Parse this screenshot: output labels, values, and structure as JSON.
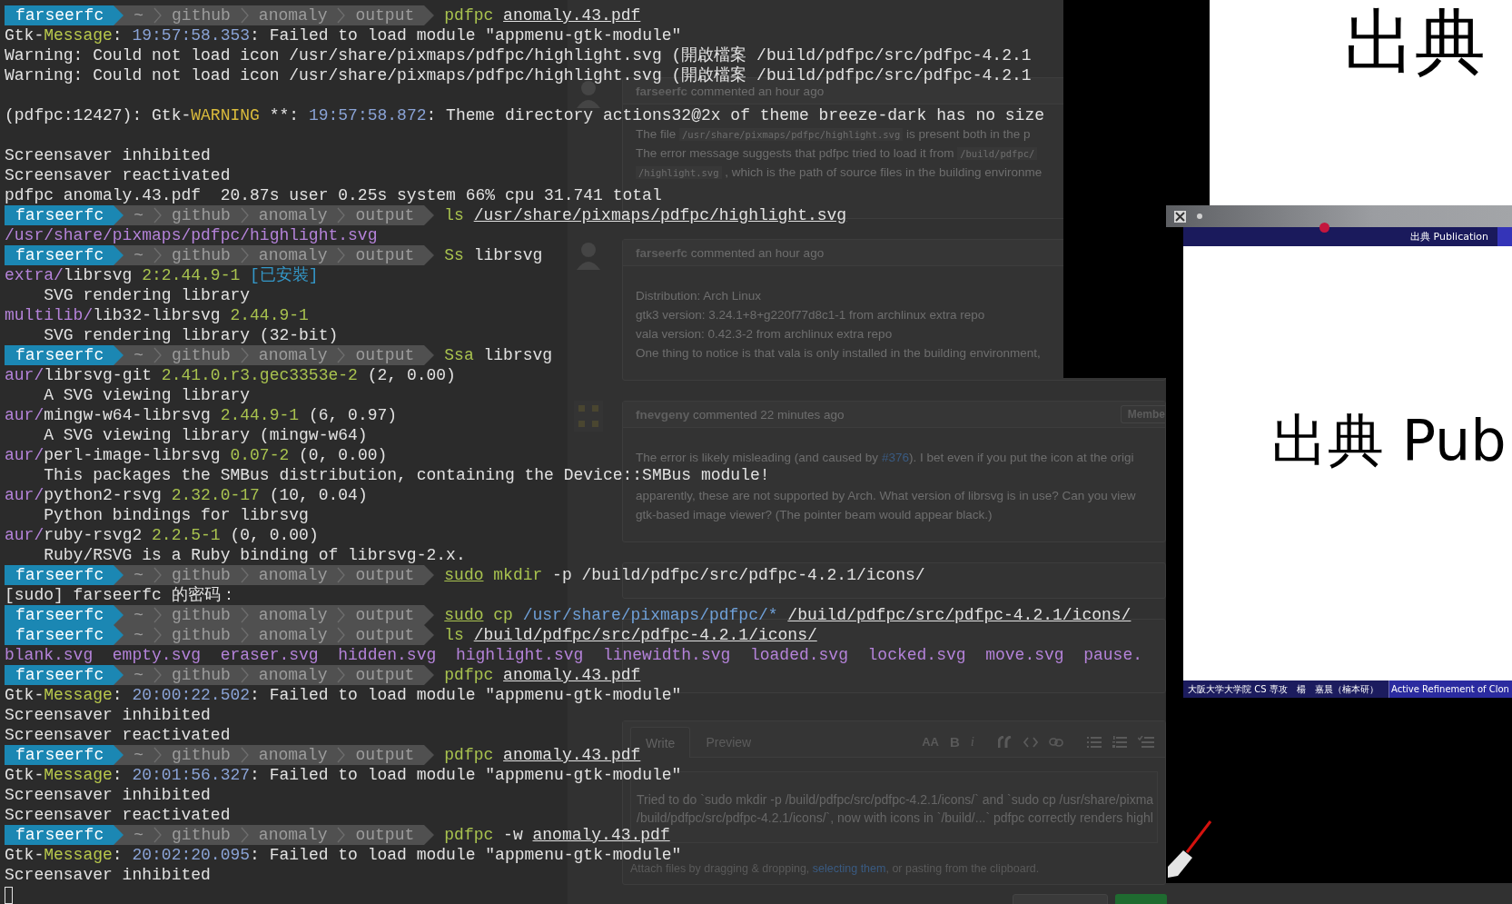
{
  "terminal": {
    "lines": [
      {
        "kind": "prompt",
        "user": "farseerfc",
        "path": [
          "~",
          "github",
          "anomaly",
          "output"
        ],
        "command": [
          {
            "kind": "cmd",
            "t": "pdfpc"
          },
          {
            "kind": "u",
            "t": "anomaly.43.pdf"
          }
        ]
      },
      {
        "kind": "text",
        "spans": [
          {
            "kind": "plain",
            "t": "Gtk-"
          },
          {
            "kind": "msg",
            "t": "Message"
          },
          {
            "kind": "plain",
            "t": ": "
          },
          {
            "kind": "time",
            "t": "19:57:58.353"
          },
          {
            "kind": "plain",
            "t": ": Failed to load module \"appmenu-gtk-module\""
          }
        ]
      },
      {
        "kind": "text",
        "spans": [
          {
            "kind": "plain",
            "t": "Warning: Could not load icon /usr/share/pixmaps/pdfpc/highlight.svg (開啟檔案 /build/pdfpc/src/pdfpc-4.2.1"
          }
        ]
      },
      {
        "kind": "text",
        "spans": [
          {
            "kind": "plain",
            "t": "Warning: Could not load icon /usr/share/pixmaps/pdfpc/highlight.svg (開啟檔案 /build/pdfpc/src/pdfpc-4.2.1"
          }
        ]
      },
      {
        "kind": "blank"
      },
      {
        "kind": "text",
        "spans": [
          {
            "kind": "plain",
            "t": "(pdfpc:12427): Gtk-"
          },
          {
            "kind": "warn",
            "t": "WARNING"
          },
          {
            "kind": "plain",
            "t": " **: "
          },
          {
            "kind": "time",
            "t": "19:57:58.872"
          },
          {
            "kind": "plain",
            "t": ": Theme directory actions32@2x of theme breeze-dark has no size"
          }
        ]
      },
      {
        "kind": "blank"
      },
      {
        "kind": "text",
        "spans": [
          {
            "kind": "plain",
            "t": "Screensaver inhibited"
          }
        ]
      },
      {
        "kind": "text",
        "spans": [
          {
            "kind": "plain",
            "t": "Screensaver reactivated"
          }
        ]
      },
      {
        "kind": "text",
        "spans": [
          {
            "kind": "plain",
            "t": "pdfpc anomaly.43.pdf  20.87s user 0.25s system 66% cpu 31.741 total"
          }
        ]
      },
      {
        "kind": "prompt",
        "user": "farseerfc",
        "path": [
          "~",
          "github",
          "anomaly",
          "output"
        ],
        "command": [
          {
            "kind": "cmd",
            "t": "ls"
          },
          {
            "kind": "u",
            "t": "/usr/share/pixmaps/pdfpc/highlight.svg"
          }
        ]
      },
      {
        "kind": "text",
        "spans": [
          {
            "kind": "purple",
            "t": "/usr/share/pixmaps/pdfpc/highlight.svg"
          }
        ]
      },
      {
        "kind": "prompt",
        "user": "farseerfc",
        "path": [
          "~",
          "github",
          "anomaly",
          "output"
        ],
        "command": [
          {
            "kind": "cmd",
            "t": "Ss"
          },
          {
            "kind": "plain",
            "t": "librsvg"
          }
        ]
      },
      {
        "kind": "text",
        "spans": [
          {
            "kind": "purple",
            "t": "extra/"
          },
          {
            "kind": "plain",
            "t": "librsvg "
          },
          {
            "kind": "ver",
            "t": "2:2.44.9-1"
          },
          {
            "kind": "cyan",
            "t": " [已安裝]"
          }
        ]
      },
      {
        "kind": "text",
        "spans": [
          {
            "kind": "plain",
            "t": "    SVG rendering library"
          }
        ]
      },
      {
        "kind": "text",
        "spans": [
          {
            "kind": "purple",
            "t": "multilib/"
          },
          {
            "kind": "plain",
            "t": "lib32-librsvg "
          },
          {
            "kind": "ver",
            "t": "2.44.9-1"
          }
        ]
      },
      {
        "kind": "text",
        "spans": [
          {
            "kind": "plain",
            "t": "    SVG rendering library (32-bit)"
          }
        ]
      },
      {
        "kind": "prompt",
        "user": "farseerfc",
        "path": [
          "~",
          "github",
          "anomaly",
          "output"
        ],
        "command": [
          {
            "kind": "cmd",
            "t": "Ssa"
          },
          {
            "kind": "plain",
            "t": "librsvg"
          }
        ]
      },
      {
        "kind": "text",
        "spans": [
          {
            "kind": "purple",
            "t": "aur/"
          },
          {
            "kind": "plain",
            "t": "librsvg-git "
          },
          {
            "kind": "ver",
            "t": "2.41.0.r3.gec3353e-2"
          },
          {
            "kind": "plain",
            "t": " (2, 0.00)"
          }
        ]
      },
      {
        "kind": "text",
        "spans": [
          {
            "kind": "plain",
            "t": "    A SVG viewing library"
          }
        ]
      },
      {
        "kind": "text",
        "spans": [
          {
            "kind": "purple",
            "t": "aur/"
          },
          {
            "kind": "plain",
            "t": "mingw-w64-librsvg "
          },
          {
            "kind": "ver",
            "t": "2.44.9-1"
          },
          {
            "kind": "plain",
            "t": " (6, 0.97)"
          }
        ]
      },
      {
        "kind": "text",
        "spans": [
          {
            "kind": "plain",
            "t": "    A SVG viewing library (mingw-w64)"
          }
        ]
      },
      {
        "kind": "text",
        "spans": [
          {
            "kind": "purple",
            "t": "aur/"
          },
          {
            "kind": "plain",
            "t": "perl-image-librsvg "
          },
          {
            "kind": "ver",
            "t": "0.07-2"
          },
          {
            "kind": "plain",
            "t": " (0, 0.00)"
          }
        ]
      },
      {
        "kind": "text",
        "spans": [
          {
            "kind": "plain",
            "t": "    This packages the SMBus distribution, containing the Device::SMBus module!"
          }
        ]
      },
      {
        "kind": "text",
        "spans": [
          {
            "kind": "purple",
            "t": "aur/"
          },
          {
            "kind": "plain",
            "t": "python2-rsvg "
          },
          {
            "kind": "ver",
            "t": "2.32.0-17"
          },
          {
            "kind": "plain",
            "t": " (10, 0.04)"
          }
        ]
      },
      {
        "kind": "text",
        "spans": [
          {
            "kind": "plain",
            "t": "    Python bindings for librsvg"
          }
        ]
      },
      {
        "kind": "text",
        "spans": [
          {
            "kind": "purple",
            "t": "aur/"
          },
          {
            "kind": "plain",
            "t": "ruby-rsvg2 "
          },
          {
            "kind": "ver",
            "t": "2.2.5-1"
          },
          {
            "kind": "plain",
            "t": " (0, 0.00)"
          }
        ]
      },
      {
        "kind": "text",
        "spans": [
          {
            "kind": "plain",
            "t": "    Ruby/RSVG is a Ruby binding of librsvg-2.x."
          }
        ]
      },
      {
        "kind": "prompt",
        "user": "farseerfc",
        "path": [
          "~",
          "github",
          "anomaly",
          "output"
        ],
        "command": [
          {
            "kind": "cmdu",
            "t": "sudo"
          },
          {
            "kind": "cmd",
            "t": "mkdir"
          },
          {
            "kind": "plain",
            "t": "-p /build/pdfpc/src/pdfpc-4.2.1/icons/"
          }
        ]
      },
      {
        "kind": "text",
        "spans": [
          {
            "kind": "plain",
            "t": "[sudo] farseerfc 的密码："
          }
        ]
      },
      {
        "kind": "prompt",
        "user": "farseerfc",
        "path": [
          "~",
          "github",
          "anomaly",
          "output"
        ],
        "command": [
          {
            "kind": "cmdu",
            "t": "sudo"
          },
          {
            "kind": "cmd",
            "t": "cp"
          },
          {
            "kind": "blue",
            "t": "/usr/share/pixmaps/pdfpc/*"
          },
          {
            "kind": "u",
            "t": "/build/pdfpc/src/pdfpc-4.2.1/icons/"
          }
        ]
      },
      {
        "kind": "prompt",
        "user": "farseerfc",
        "path": [
          "~",
          "github",
          "anomaly",
          "output"
        ],
        "command": [
          {
            "kind": "cmd",
            "t": "ls"
          },
          {
            "kind": "u",
            "t": "/build/pdfpc/src/pdfpc-4.2.1/icons/"
          }
        ]
      },
      {
        "kind": "text",
        "spans": [
          {
            "kind": "purple",
            "t": "blank.svg  empty.svg  eraser.svg  hidden.svg  highlight.svg  linewidth.svg  loaded.svg  locked.svg  move.svg  pause."
          }
        ]
      },
      {
        "kind": "prompt",
        "user": "farseerfc",
        "path": [
          "~",
          "github",
          "anomaly",
          "output"
        ],
        "command": [
          {
            "kind": "cmd",
            "t": "pdfpc"
          },
          {
            "kind": "u",
            "t": "anomaly.43.pdf"
          }
        ]
      },
      {
        "kind": "text",
        "spans": [
          {
            "kind": "plain",
            "t": "Gtk-"
          },
          {
            "kind": "msg",
            "t": "Message"
          },
          {
            "kind": "plain",
            "t": ": "
          },
          {
            "kind": "time",
            "t": "20:00:22.502"
          },
          {
            "kind": "plain",
            "t": ": Failed to load module \"appmenu-gtk-module\""
          }
        ]
      },
      {
        "kind": "text",
        "spans": [
          {
            "kind": "plain",
            "t": "Screensaver inhibited"
          }
        ]
      },
      {
        "kind": "text",
        "spans": [
          {
            "kind": "plain",
            "t": "Screensaver reactivated"
          }
        ]
      },
      {
        "kind": "prompt",
        "user": "farseerfc",
        "path": [
          "~",
          "github",
          "anomaly",
          "output"
        ],
        "command": [
          {
            "kind": "cmd",
            "t": "pdfpc"
          },
          {
            "kind": "u",
            "t": "anomaly.43.pdf"
          }
        ]
      },
      {
        "kind": "text",
        "spans": [
          {
            "kind": "plain",
            "t": "Gtk-"
          },
          {
            "kind": "msg",
            "t": "Message"
          },
          {
            "kind": "plain",
            "t": ": "
          },
          {
            "kind": "time",
            "t": "20:01:56.327"
          },
          {
            "kind": "plain",
            "t": ": Failed to load module \"appmenu-gtk-module\""
          }
        ]
      },
      {
        "kind": "text",
        "spans": [
          {
            "kind": "plain",
            "t": "Screensaver inhibited"
          }
        ]
      },
      {
        "kind": "text",
        "spans": [
          {
            "kind": "plain",
            "t": "Screensaver reactivated"
          }
        ]
      },
      {
        "kind": "prompt",
        "user": "farseerfc",
        "path": [
          "~",
          "github",
          "anomaly",
          "output"
        ],
        "command": [
          {
            "kind": "cmd",
            "t": "pdfpc"
          },
          {
            "kind": "plain",
            "t": "-w"
          },
          {
            "kind": "u",
            "t": "anomaly.43.pdf"
          }
        ]
      },
      {
        "kind": "text",
        "spans": [
          {
            "kind": "plain",
            "t": "Gtk-"
          },
          {
            "kind": "msg",
            "t": "Message"
          },
          {
            "kind": "plain",
            "t": ": "
          },
          {
            "kind": "time",
            "t": "20:02:20.095"
          },
          {
            "kind": "plain",
            "t": ": Failed to load module \"appmenu-gtk-module\""
          }
        ]
      },
      {
        "kind": "text",
        "spans": [
          {
            "kind": "plain",
            "t": "Screensaver inhibited"
          }
        ]
      },
      {
        "kind": "cursor"
      }
    ]
  },
  "github": {
    "comments": [
      {
        "avatar": {
          "kind": "silhouette"
        },
        "header": "**farseerfc** commented an hour ago",
        "body": [
          {
            "kind": "text",
            "spans": [
              {
                "kind": "plain",
                "t": "The file "
              },
              {
                "kind": "code",
                "t": "/usr/share/pixmaps/pdfpc/highlight.svg"
              },
              {
                "kind": "plain",
                "t": " is present both in the p"
              }
            ]
          },
          {
            "kind": "text",
            "spans": [
              {
                "kind": "plain",
                "t": "The error message suggests that pdfpc tried to load it from "
              },
              {
                "kind": "code",
                "t": "/build/pdfpc/"
              }
            ]
          },
          {
            "kind": "text",
            "spans": [
              {
                "kind": "code",
                "t": "/highlight.svg"
              },
              {
                "kind": "plain",
                "t": " , which is the path of source files in the building environme"
              }
            ]
          },
          {
            "kind": "covered"
          }
        ]
      },
      {
        "avatar": {
          "kind": "silhouette"
        },
        "header": "**farseerfc** commented an hour ago",
        "body": [
          {
            "kind": "text",
            "spans": [
              {
                "kind": "plain",
                "t": "Distribution: Arch Linux"
              }
            ]
          },
          {
            "kind": "text",
            "spans": [
              {
                "kind": "plain",
                "t": "gtk3 version: 3.24.1+8+g220f77d8c1-1 from archlinux extra repo"
              }
            ]
          },
          {
            "kind": "text",
            "spans": [
              {
                "kind": "plain",
                "t": "vala version: 0.42.3-2 from archlinux extra repo"
              }
            ]
          },
          {
            "kind": "text",
            "spans": [
              {
                "kind": "plain",
                "t": "One thing to notice is that vala is only installed in the building environment,"
              }
            ]
          }
        ]
      },
      {
        "avatar": {
          "kind": "identicon"
        },
        "header": "**fnevgeny** commented 22 minutes ago",
        "badge": "Membe",
        "body": [
          {
            "kind": "text",
            "spans": [
              {
                "kind": "plain",
                "t": "The error is likely misleading (and caused by "
              },
              {
                "kind": "link",
                "t": "#376"
              },
              {
                "kind": "plain",
                "t": "). I bet even if you put the icon at the origi"
              }
            ]
          },
          {
            "kind": "covered"
          },
          {
            "kind": "text",
            "spans": [
              {
                "kind": "plain",
                "t": "apparently, these are not supported by Arch. What version of librsvg is in use? Can you view"
              }
            ]
          },
          {
            "kind": "text",
            "spans": [
              {
                "kind": "plain",
                "t": "gtk-based image viewer? (The pointer beam would appear black.)"
              }
            ]
          }
        ]
      }
    ],
    "editor": {
      "tabs": [
        {
          "label": "Write",
          "selected": true
        },
        {
          "label": "Preview",
          "selected": false
        }
      ],
      "tools": [
        {
          "kind": "size",
          "label": "AA"
        },
        {
          "kind": "bold",
          "label": "B"
        },
        {
          "kind": "italic",
          "label": "i"
        },
        {
          "kind": "quote"
        },
        {
          "kind": "code"
        },
        {
          "kind": "link"
        },
        {
          "kind": "bullets"
        },
        {
          "kind": "numbers"
        },
        {
          "kind": "tasks"
        }
      ],
      "value_lines": [
        "Tried to do `sudo mkdir -p /build/pdfpc/src/pdfpc-4.2.1/icons/` and `sudo cp /usr/share/pixma",
        "/build/pdfpc/src/pdfpc-4.2.1/icons/`, now with icons in `/build/...` pdfpc correctly renders highl"
      ],
      "attach": [
        {
          "kind": "plain",
          "t": "Attach files by dragging & dropping, "
        },
        {
          "kind": "link",
          "t": "selecting them"
        },
        {
          "kind": "plain",
          "t": ", or pasting from the clipboard."
        }
      ]
    }
  },
  "presentation": {
    "heading": "出典"
  },
  "pdfpc_window": {
    "header": "出典 Publication",
    "slide_title": "出典 Pub",
    "footer_left": "大阪大学大学院 CS 専攻　楊　嘉晨（楠本研）",
    "footer_right": "Active Refinement of Clon"
  }
}
